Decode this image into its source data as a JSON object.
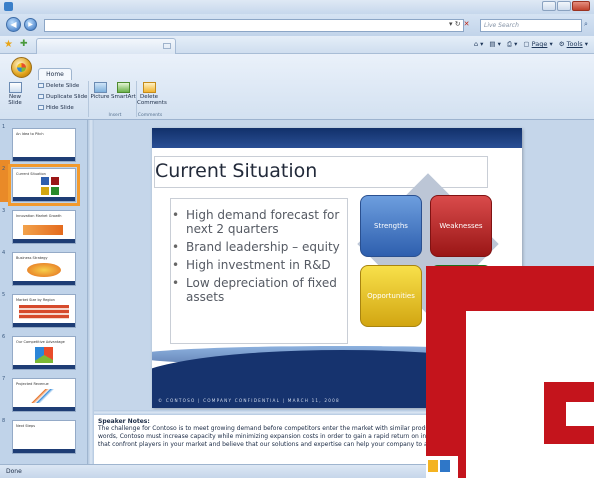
{
  "browser": {
    "back_glyph": "◀",
    "forward_glyph": "▶",
    "search_placeholder": "Live Search",
    "command_bar": {
      "page_label": "Page",
      "tools_label": "Tools"
    }
  },
  "ribbon": {
    "tab_home": "Home",
    "new_slide": "New Slide",
    "delete_slide": "Delete Slide",
    "duplicate_slide": "Duplicate Slide",
    "hide_slide": "Hide Slide",
    "picture": "Picture",
    "smartart": "SmartArt",
    "delete_comments": "Delete Comments",
    "group_insert": "Insert",
    "group_comments": "Comments"
  },
  "thumbnails": [
    {
      "num": "1",
      "title": "An Idea to Pitch"
    },
    {
      "num": "2",
      "title": "Current Situation",
      "selected": true
    },
    {
      "num": "3",
      "title": "Innovation Market Growth"
    },
    {
      "num": "4",
      "title": "Business Strategy"
    },
    {
      "num": "5",
      "title": "Market Size by Region"
    },
    {
      "num": "6",
      "title": "Our Competitive Advantage"
    },
    {
      "num": "7",
      "title": "Projected Revenue"
    },
    {
      "num": "8",
      "title": "Next Steps"
    }
  ],
  "slide": {
    "title": "Current Situation",
    "bullets": [
      "High demand forecast for next 2 quarters",
      "Brand leadership – equity",
      "High investment in R&D",
      "Low depreciation of fixed assets"
    ],
    "swot": {
      "strengths": "Strengths",
      "weaknesses": "Weaknesses",
      "opportunities": "Opportunities",
      "threats": ""
    },
    "footer": "© CONTOSO  |  COMPANY CONFIDENTIAL  |  MARCH 11, 2008"
  },
  "notes": {
    "heading": "Speaker Notes:",
    "line1": "The challenge for Contoso is to meet growing demand before competitors enter the market with similar produ",
    "line2": "words, Contoso must increase capacity while minimizing expansion costs in order to gain a rapid return on inve",
    "line3": "that confront players in your market and believe that our solutions and expertise can help your company to ad"
  },
  "status": {
    "text": "Done"
  },
  "colors": {
    "slide_banner": "#16336e",
    "strengths": "#2e5fae",
    "weaknesses": "#9a1616",
    "opportunities": "#d2a612",
    "threats": "#2a8a2a",
    "logo_red": "#c4141c",
    "selection_orange": "#f29a2e"
  }
}
